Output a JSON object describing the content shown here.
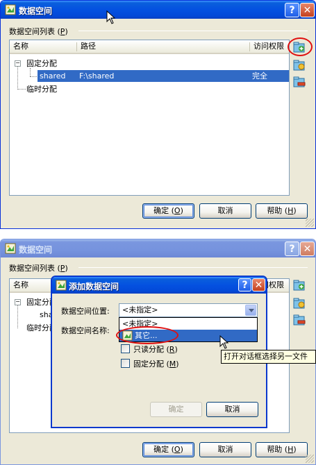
{
  "main_window": {
    "title": "数据空间",
    "group_label": "数据空间列表",
    "group_hotkey": "P",
    "columns": [
      "名称",
      "路径",
      "访问权限"
    ],
    "tree": {
      "fixed_label": "固定分配",
      "temp_label": "临时分配",
      "row": {
        "name": "shared",
        "path": "F:\\shared",
        "access": "完全"
      }
    },
    "buttons": {
      "ok": "确定",
      "ok_hotkey": "O",
      "cancel": "取消",
      "help": "帮助",
      "help_hotkey": "H"
    },
    "help_glyph": "?",
    "close_glyph": "✕"
  },
  "add_dialog": {
    "title": "添加数据空间",
    "location_label": "数据空间位置:",
    "name_label": "数据空间名称:",
    "combo_value": "<未指定>",
    "dropdown_items": [
      "<未指定>",
      "其它..."
    ],
    "readonly_label": "只读分配",
    "readonly_hotkey": "R",
    "fixed_label": "固定分配",
    "fixed_hotkey": "M",
    "ok": "确定",
    "cancel": "取消",
    "tooltip": "打开对话框选择另一文件"
  },
  "colors": {
    "accent": "#0451e0",
    "selection": "#316ac5",
    "face": "#ece9d8",
    "highlight_ring": "#e01010"
  },
  "icons": {
    "app": "data-space-icon",
    "side": [
      "add-space-icon",
      "edit-space-icon",
      "remove-space-icon"
    ]
  }
}
